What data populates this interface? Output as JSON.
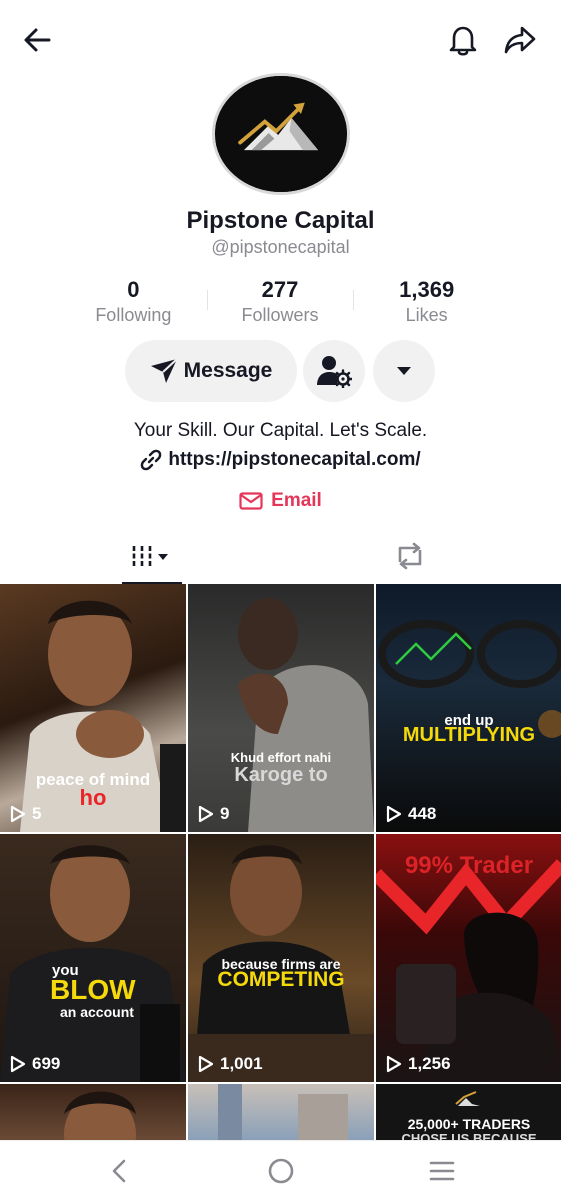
{
  "profile": {
    "name": "Pipstone Capital",
    "handle": "@pipstonecapital",
    "bio": "Your Skill. Our Capital. Let's Scale.",
    "link": "https://pipstonecapital.com/",
    "email_label": "Email"
  },
  "stats": [
    {
      "value": "0",
      "label": "Following"
    },
    {
      "value": "277",
      "label": "Followers"
    },
    {
      "value": "1,369",
      "label": "Likes"
    }
  ],
  "actions": {
    "message_label": "Message"
  },
  "videos": [
    {
      "views": "5",
      "caption_top": "peace of mind",
      "caption_main": "ho"
    },
    {
      "views": "9",
      "caption_top": "Khud effort nahi",
      "caption_main": "Karoge to"
    },
    {
      "views": "448",
      "caption_top": "end up",
      "caption_main": "MULTIPLYING"
    },
    {
      "views": "699",
      "caption_top": "you",
      "caption_main": "BLOW",
      "caption_bottom": "an account"
    },
    {
      "views": "1,001",
      "caption_top": "because firms are",
      "caption_main": "COMPETING"
    },
    {
      "views": "1,256",
      "caption_top": "99% Trader",
      "caption_main": ""
    },
    {
      "views": "",
      "caption_top": "",
      "caption_main": ""
    },
    {
      "views": "",
      "caption_top": "",
      "caption_main": ""
    },
    {
      "views": "",
      "caption_top": "25,000+ TRADERS",
      "caption_main": "CHOSE US BECAUSE"
    }
  ],
  "colors": {
    "accent_red": "#e5365a",
    "caption_yellow": "#f5d90a",
    "caption_red": "#e8262a",
    "text_primary": "#161823",
    "text_secondary": "#8a8b91"
  }
}
